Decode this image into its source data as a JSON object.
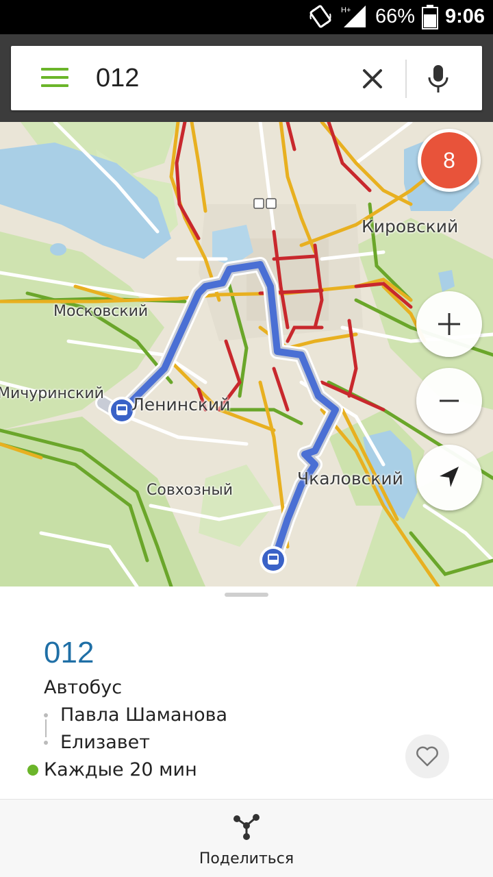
{
  "status_bar": {
    "network": "H+",
    "battery_percent": "66%",
    "time": "9:06"
  },
  "search": {
    "query": "012"
  },
  "map": {
    "traffic_level": "8",
    "districts": {
      "kirovsky": "Кировский",
      "moskovsky": "Московский",
      "michurinsky": "Мичуринский",
      "leninsky": "Ленинский",
      "sovkhozny": "Совхозный",
      "chkalovsky": "Чкаловский"
    },
    "route_color": "#4a6fd4",
    "traffic_colors": {
      "free": "#6aa62a",
      "slow": "#e8b020",
      "jam": "#c8282d"
    }
  },
  "route_card": {
    "number": "012",
    "type": "Автобус",
    "stop_from": "Павла Шаманова",
    "stop_to": "Елизавет",
    "frequency": "Каждые 20 мин",
    "accent_color": "#1f6fa6"
  },
  "bottom_bar": {
    "share_label": "Поделиться"
  }
}
